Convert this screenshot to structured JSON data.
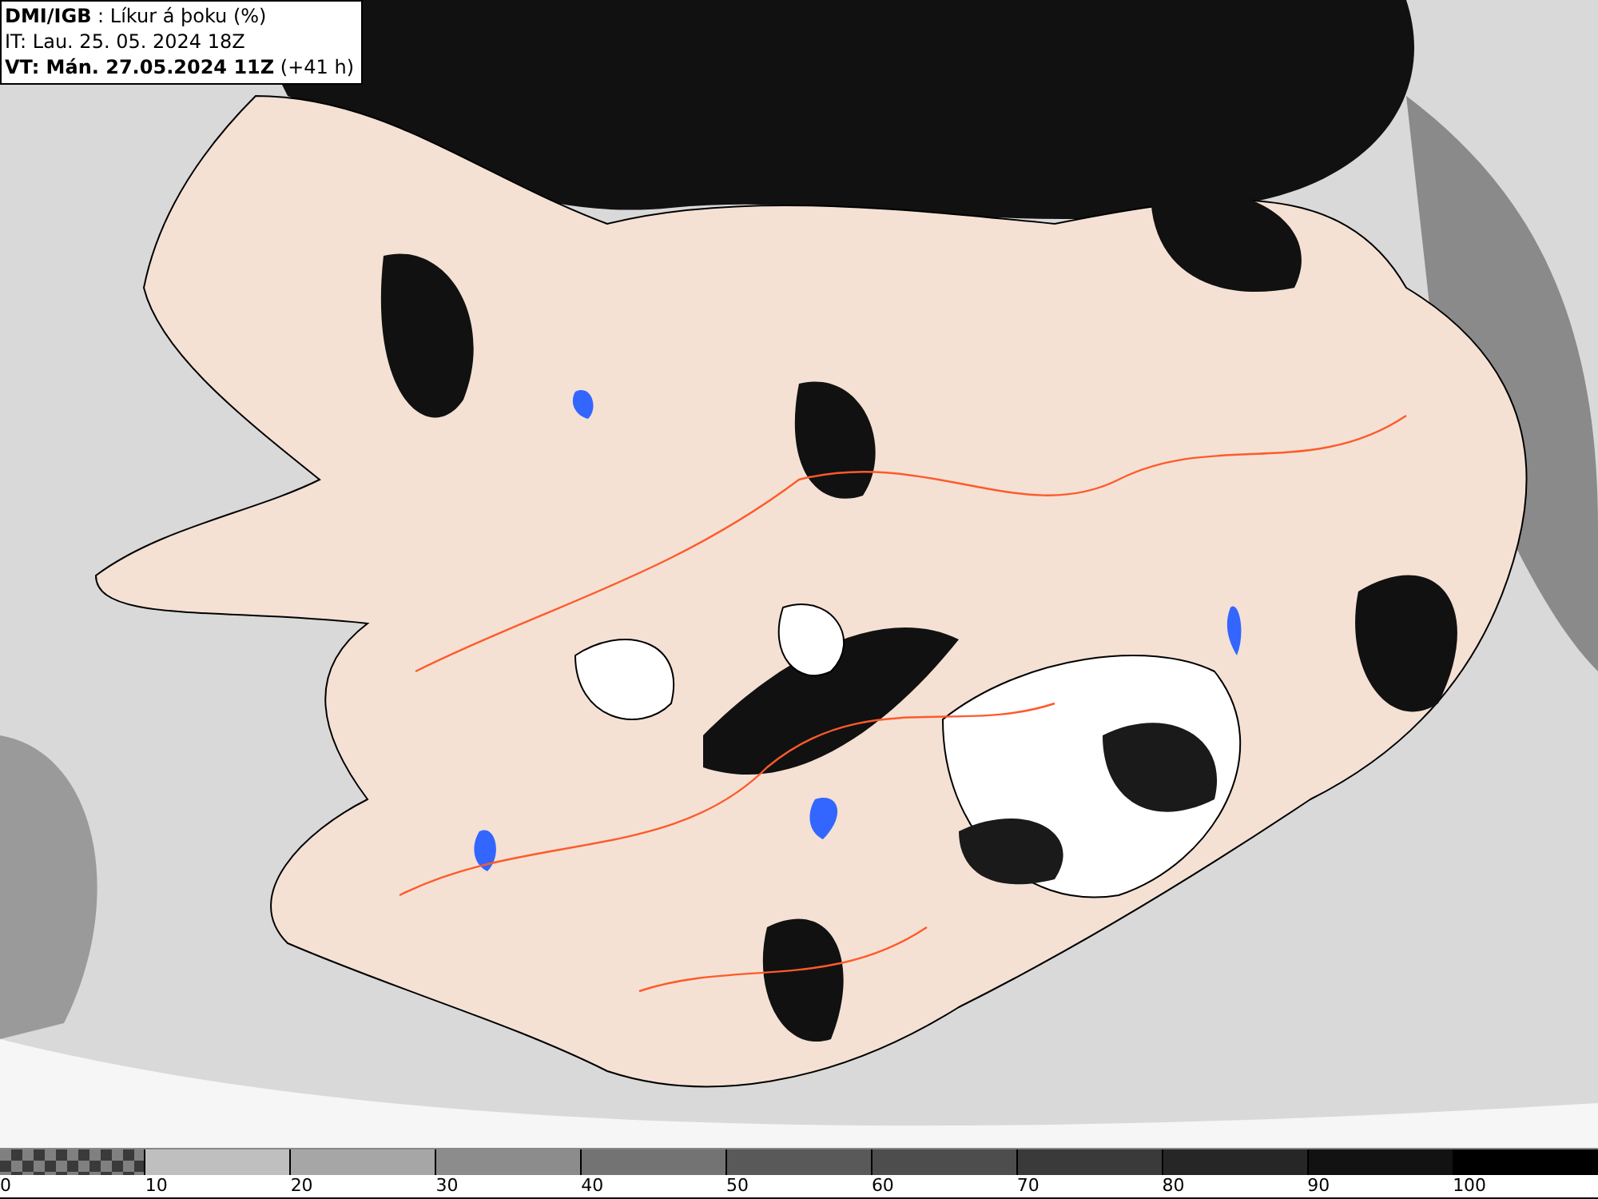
{
  "title_box": {
    "lines": [
      "**DMI/IGB** : Líkur á þoku (%)",
      "IT: Lau. 25. 05. 2024 18Z",
      "**VT: Mán. 27.05.2024 11Z** (+41 h)"
    ]
  },
  "legend": {
    "segments": [
      {
        "kind": "checkered",
        "color": "#3a3a3a"
      },
      {
        "kind": "solid",
        "color": "#bfbfbf"
      },
      {
        "kind": "solid",
        "color": "#a6a6a6"
      },
      {
        "kind": "solid",
        "color": "#8c8c8c"
      },
      {
        "kind": "solid",
        "color": "#737373"
      },
      {
        "kind": "solid",
        "color": "#595959"
      },
      {
        "kind": "solid",
        "color": "#4d4d4d"
      },
      {
        "kind": "solid",
        "color": "#3a3a3a"
      },
      {
        "kind": "solid",
        "color": "#262626"
      },
      {
        "kind": "solid",
        "color": "#121212"
      },
      {
        "kind": "solid",
        "color": "#000000"
      }
    ],
    "ticks": [
      "0",
      "10",
      "20",
      "30",
      "40",
      "50",
      "60",
      "70",
      "80",
      "90",
      "100"
    ]
  }
}
